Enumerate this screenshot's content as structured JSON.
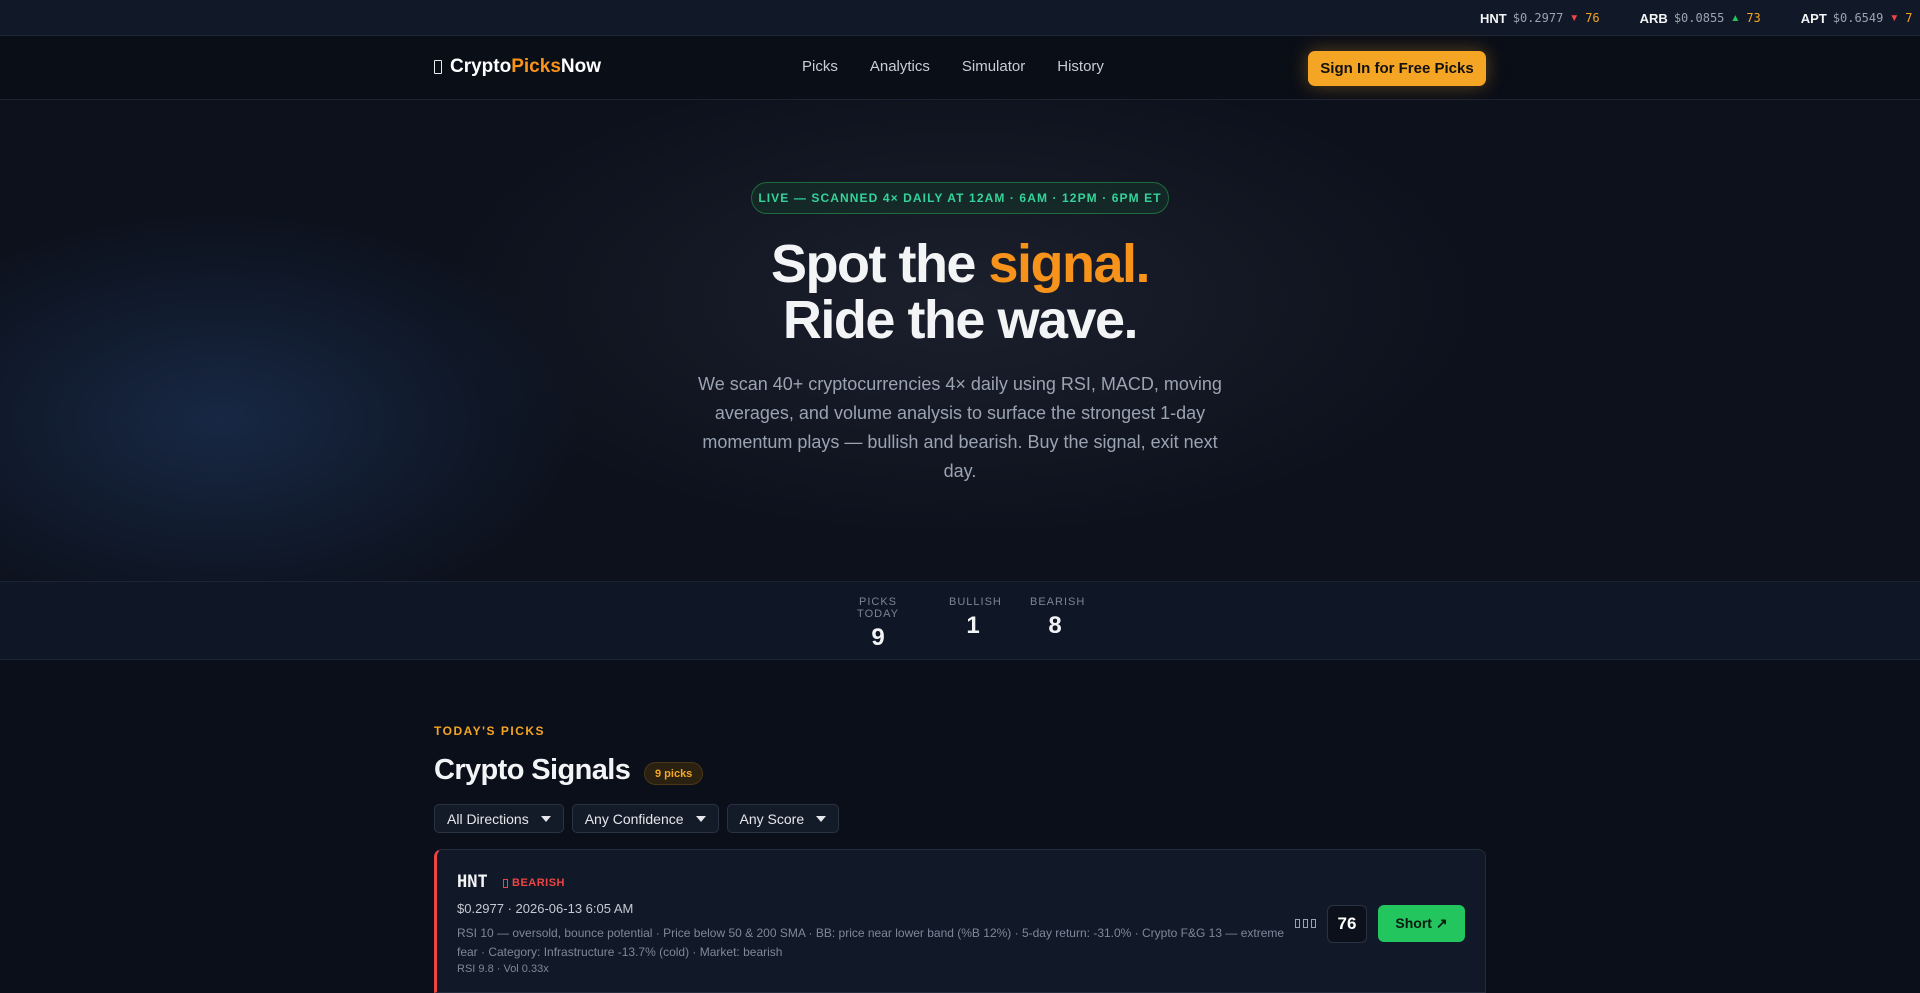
{
  "ticker": [
    {
      "symbol": "HNT",
      "price": "$0.2977",
      "direction": "down",
      "arrow": "▼",
      "score": "76"
    },
    {
      "symbol": "ARB",
      "price": "$0.0855",
      "direction": "up",
      "arrow": "▲",
      "score": "73"
    },
    {
      "symbol": "APT",
      "price": "$0.6549",
      "direction": "down",
      "arrow": "▼",
      "score": "7"
    }
  ],
  "nav": {
    "logo": {
      "part1": "Crypto",
      "part2": "Picks",
      "part3": "Now"
    },
    "links": [
      "Picks",
      "Analytics",
      "Simulator",
      "History"
    ],
    "cta": "Sign In for Free Picks"
  },
  "hero": {
    "pill": "LIVE — SCANNED 4× DAILY AT 12AM · 6AM · 12PM · 6PM ET",
    "headline_1a": "Spot the ",
    "headline_1b": "signal.",
    "headline_2": "Ride the wave.",
    "subtitle": "We scan 40+ cryptocurrencies 4× daily using RSI, MACD, moving averages, and volume analysis to surface the strongest 1-day momentum plays — bullish and bearish. Buy the signal, exit next day."
  },
  "stats": [
    {
      "label": "PICKS TODAY",
      "value": "9"
    },
    {
      "label": "BULLISH",
      "value": "1"
    },
    {
      "label": "BEARISH",
      "value": "8"
    }
  ],
  "picks": {
    "eyebrow": "TODAY'S PICKS",
    "title": "Crypto Signals",
    "count": "9 picks",
    "filters": [
      "All Directions",
      "Any Confidence",
      "Any Score"
    ],
    "cards": [
      {
        "symbol": "HNT",
        "direction": "BEARISH",
        "price_line": "$0.2977 · 2026-06-13 6:05 AM",
        "reasons": "RSI 10 — oversold, bounce potential · Price below 50 & 200 SMA · BB: price near lower band (%B 12%) · 5-day return: -31.0% · Crypto F&G 13 — extreme fear · Category: Infrastructure -13.7% (cold) · Market: bearish",
        "meta": "RSI 9.8 · Vol 0.33x",
        "score": "76",
        "action": "Short ↗"
      }
    ]
  },
  "colors": {
    "accent": "#f7931a",
    "cta": "#f5a524",
    "bearish": "#ef4444",
    "bullish": "#22c55e",
    "live": "#34d399"
  }
}
